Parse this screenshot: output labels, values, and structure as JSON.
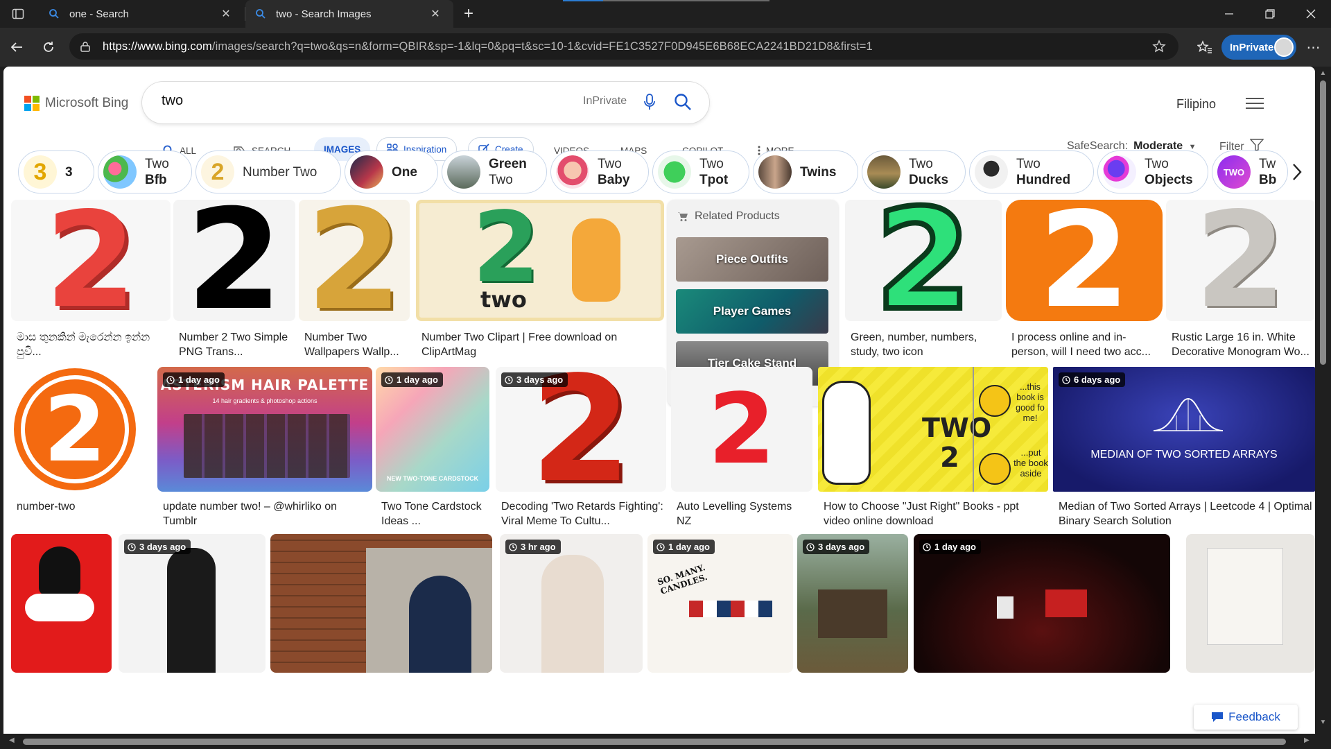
{
  "browser": {
    "tabs": [
      {
        "title": "one - Search",
        "active": false
      },
      {
        "title": "two - Search Images",
        "active": true
      }
    ],
    "url_host": "https://www.bing.com",
    "url_path": "/images/search?q=two&qs=n&form=QBIR&sp=-1&lq=0&pq=t&sc=10-1&cvid=FE1C3527F0D945E6B68ECA2241BD21D8&first=1",
    "inprivate_label": "InPrivate",
    "accent": "#1f66b8"
  },
  "header": {
    "logo_text": "Microsoft Bing",
    "query": "two",
    "inprivate_hint": "InPrivate",
    "language": "Filipino"
  },
  "scopes": [
    {
      "label": "ALL",
      "icon": "search-icon"
    },
    {
      "label": "SEARCH",
      "icon": "copilot-search-icon"
    },
    {
      "label": "IMAGES",
      "active": true
    },
    {
      "label": "Inspiration",
      "icon": "inspiration-icon"
    },
    {
      "label": "Create",
      "icon": "create-icon"
    },
    {
      "label": "VIDEOS"
    },
    {
      "label": "MAPS"
    },
    {
      "label": "COPILOT"
    },
    {
      "label": "MORE",
      "icon": "more-vertical-icon"
    }
  ],
  "safesearch": {
    "label": "SafeSearch:",
    "value": "Moderate"
  },
  "filter_label": "Filter",
  "chips": [
    {
      "line1": "3",
      "line2": ""
    },
    {
      "line1": "Two",
      "line2": "Bfb"
    },
    {
      "line1": "Number Two",
      "line2": ""
    },
    {
      "line1": "One",
      "line2": ""
    },
    {
      "line1": "Green",
      "line2": "Two"
    },
    {
      "line1": "Two",
      "line2": "Baby"
    },
    {
      "line1": "Two",
      "line2": "Tpot"
    },
    {
      "line1": "Twins",
      "line2": ""
    },
    {
      "line1": "Two",
      "line2": "Ducks"
    },
    {
      "line1": "Two",
      "line2": "Hundred"
    },
    {
      "line1": "Two",
      "line2": "Objects"
    },
    {
      "line1": "Tw",
      "line2": "Bb"
    }
  ],
  "related_products": {
    "title": "Related Products",
    "items": [
      "Piece Outfits",
      "Player Games",
      "Tier Cake Stand"
    ]
  },
  "row1": [
    {
      "caption": "මාස තුනකින් මැරෙන්න ඉන්න පුවි...",
      "glyph": "2"
    },
    {
      "caption": "Number 2 Two Simple PNG Trans...",
      "glyph": "2"
    },
    {
      "caption": "Number Two Wallpapers Wallp...",
      "glyph": "2"
    },
    {
      "caption": "Number Two Clipart | Free download on ClipArtMag",
      "glyph": "2",
      "subtext": "two"
    },
    {
      "caption": "Green, number, numbers, study, two icon",
      "glyph": "2"
    },
    {
      "caption": "I process online and in-person, will I need two acc...",
      "glyph": "2"
    },
    {
      "caption": "Rustic Large 16 in. White Decorative Monogram Wo...",
      "glyph": "2"
    }
  ],
  "row2": [
    {
      "caption": "number-two",
      "glyph": "2"
    },
    {
      "caption": "update number two! – @whirliko on Tumblr",
      "badge": "1 day ago",
      "heading": "ASTERISM HAIR PALETTE",
      "sub": "14 hair gradients & photoshop actions"
    },
    {
      "caption": "Two Tone Cardstock Ideas ...",
      "badge": "1 day ago",
      "sub": "NEW TWO-TONE CARDSTOCK"
    },
    {
      "caption": "Decoding 'Two Retards Fighting': Viral Meme To Cultu...",
      "badge": "3 days ago",
      "glyph": "2"
    },
    {
      "caption": "Auto Levelling Systems NZ",
      "glyph": "2"
    },
    {
      "caption": "How to Choose \"Just Right\" Books - ppt video online download",
      "heading": "TWO",
      "glyph": "2",
      "note1": "...this book is good fo me!",
      "note2": "...put the book aside"
    },
    {
      "caption": "Median of Two Sorted Arrays | Leetcode 4 | Optimal Binary Search Solution",
      "badge": "6 days ago",
      "heading": "MEDIAN OF TWO SORTED ARRAYS"
    }
  ],
  "row3": [
    {
      "badge": ""
    },
    {
      "badge": "3 days ago"
    },
    {
      "badge": ""
    },
    {
      "badge": "3 hr ago"
    },
    {
      "badge": "1 day ago",
      "text": "SO. MANY. CANDLES."
    },
    {
      "badge": "3 days ago"
    },
    {
      "badge": "1 day ago"
    },
    {
      "badge": ""
    }
  ],
  "feedback_label": "Feedback"
}
